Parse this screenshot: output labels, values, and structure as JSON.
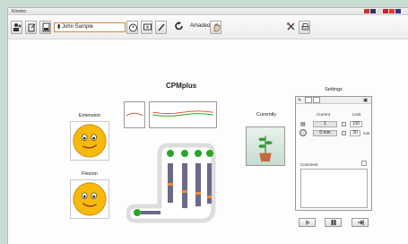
{
  "window": {
    "title": "Kinetec"
  },
  "toolbar": {
    "user_name": "John Sample",
    "mode_label": "Amadeo"
  },
  "main": {
    "title": "CPMplus",
    "extension_label": "Extension",
    "flexion_label": "Flexion",
    "currently_label": "Currently"
  },
  "settings": {
    "title": "Settings",
    "current_header": "Current",
    "limit_header": "Limit",
    "reps_value": "1",
    "reps_limit": "100",
    "time_value": "0 min",
    "time_limit": "30",
    "time_unit": "min",
    "comment_label": "Comment"
  },
  "colors": {
    "accent": "#d08a3c",
    "finger_dot": "#2aa52a"
  }
}
